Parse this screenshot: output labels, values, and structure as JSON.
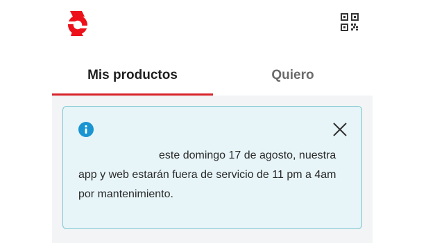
{
  "app": {
    "brand_color": "#ec111a",
    "icons": {
      "logo": "scotiabank-logo",
      "qr": "qr-code-icon"
    }
  },
  "tabs": [
    {
      "label": "Mis productos",
      "active": true
    },
    {
      "label": "Quiero",
      "active": false
    }
  ],
  "notice": {
    "icon": "info-icon",
    "close_icon": "close-icon",
    "message": "este domingo 17 de agosto, nuestra app y web estarán fuera de servicio de 11 pm a 4am por mantenimiento."
  }
}
